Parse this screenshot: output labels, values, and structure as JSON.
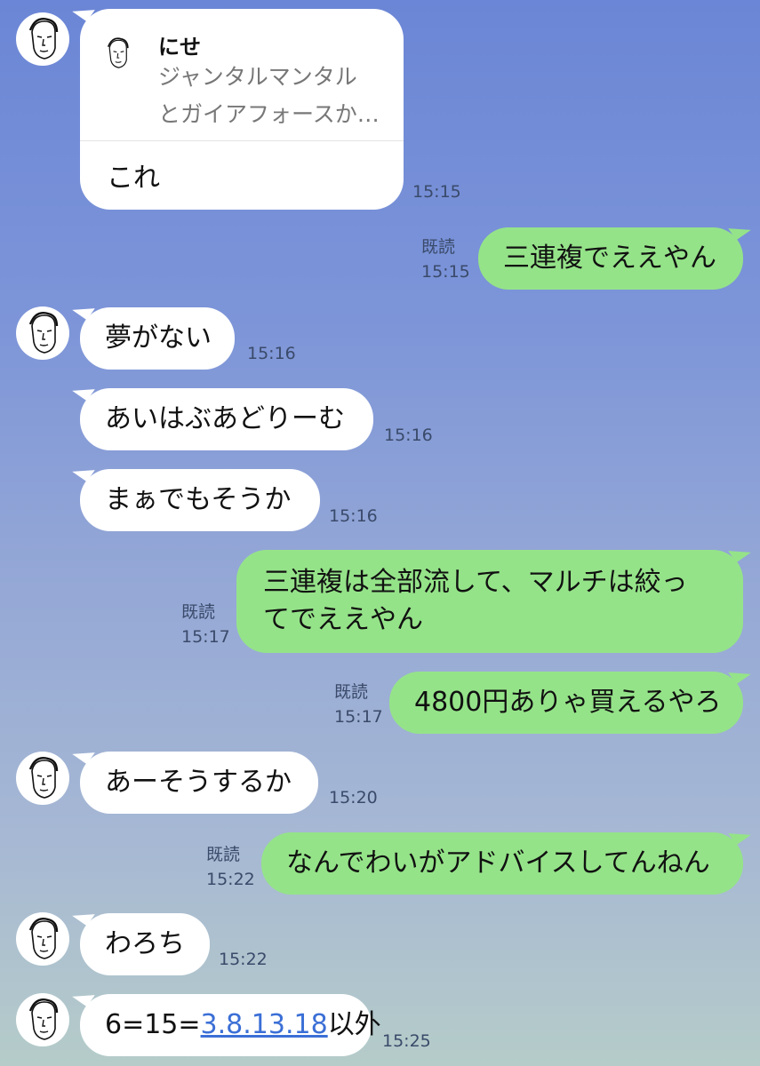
{
  "reply_message": {
    "quoted_name": "にせ",
    "quoted_line1": "ジャンタルマンタル",
    "quoted_line2": "とガイアフォースか…",
    "text": "これ",
    "time": "15:15"
  },
  "messages": [
    {
      "dir": "out",
      "text": "三連複でええやん",
      "read": "既読",
      "time": "15:15"
    },
    {
      "dir": "in",
      "text": "夢がない",
      "time": "15:16"
    },
    {
      "dir": "in",
      "text": "あいはぶあどりーむ",
      "time": "15:16"
    },
    {
      "dir": "in",
      "text": "まぁでもそうか",
      "time": "15:16"
    },
    {
      "dir": "out",
      "line1": "三連複は全部流して、マルチは絞っ",
      "line2": "てでええやん",
      "read": "既読",
      "time": "15:17"
    },
    {
      "dir": "out",
      "text": "4800円ありゃ買えるやろ",
      "read": "既読",
      "time": "15:17"
    },
    {
      "dir": "in",
      "text": "あーそうするか",
      "time": "15:20"
    },
    {
      "dir": "out",
      "text": "なんでわいがアドバイスしてんねん",
      "read": "既読",
      "time": "15:22"
    },
    {
      "dir": "in",
      "text": "わろち",
      "time": "15:22"
    },
    {
      "dir": "in",
      "prefix": "6=15=",
      "link": "3.8.13.18",
      "suffix": "以外",
      "time": "15:25"
    }
  ],
  "icons": {
    "avatar": "face-sketch-avatar"
  },
  "colors": {
    "incoming": "#ffffff",
    "outgoing": "#95e389",
    "link": "#3b6fd6"
  }
}
